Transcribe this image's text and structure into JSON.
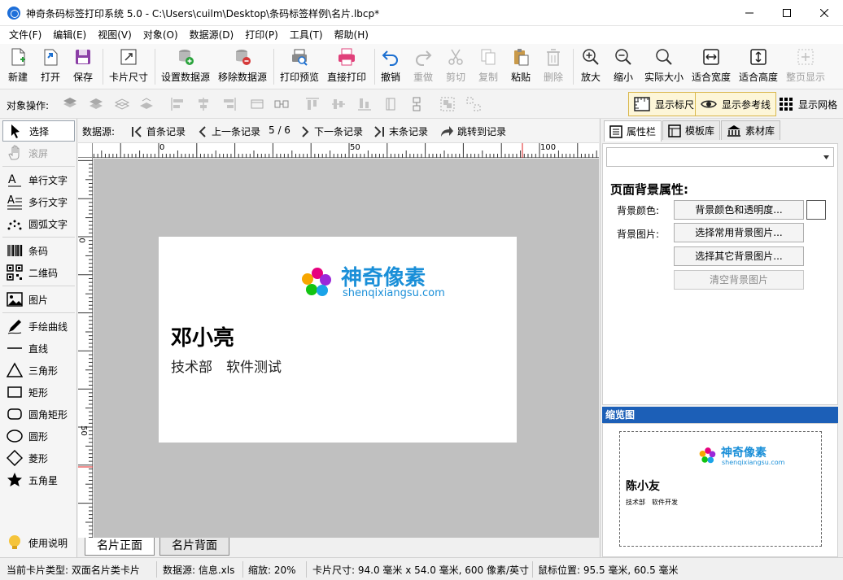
{
  "window": {
    "title": "神奇条码标签打印系统 5.0 - C:\\Users\\cuilm\\Desktop\\条码标签样例\\名片.lbcp*"
  },
  "menu": [
    "文件(F)",
    "编辑(E)",
    "视图(V)",
    "对象(O)",
    "数据源(D)",
    "打印(P)",
    "工具(T)",
    "帮助(H)"
  ],
  "toolbar": {
    "new": "新建",
    "open": "打开",
    "save": "保存",
    "card_size": "卡片尺寸",
    "set_datasource": "设置数据源",
    "remove_datasource": "移除数据源",
    "print_preview": "打印预览",
    "direct_print": "直接打印",
    "undo": "撤销",
    "redo": "重做",
    "cut": "剪切",
    "copy": "复制",
    "paste": "粘贴",
    "delete": "删除",
    "zoom_in": "放大",
    "zoom_out": "缩小",
    "actual_size": "实际大小",
    "fit_width": "适合宽度",
    "fit_height": "适合高度",
    "fit_page": "整页显示"
  },
  "objbar": {
    "label": "对象操作:",
    "show_ruler": "显示标尺",
    "show_guides": "显示参考线",
    "show_grid": "显示网格"
  },
  "tools": {
    "select": "选择",
    "pan": "滚屏",
    "single_text": "单行文字",
    "multi_text": "多行文字",
    "arc_text": "圆弧文字",
    "barcode": "条码",
    "qrcode": "二维码",
    "image": "图片",
    "freehand": "手绘曲线",
    "line": "直线",
    "triangle": "三角形",
    "rect": "矩形",
    "round_rect": "圆角矩形",
    "ellipse": "圆形",
    "diamond": "菱形",
    "star": "五角星",
    "help": "使用说明"
  },
  "nav": {
    "label": "数据源:",
    "first": "首条记录",
    "prev": "上一条记录",
    "counter": "5 / 6",
    "next": "下一条记录",
    "last": "末条记录",
    "jump": "跳转到记录"
  },
  "ruler": {
    "h": [
      "0",
      "50",
      "100"
    ],
    "v": [
      "0",
      "50"
    ]
  },
  "card": {
    "logo_cn": "神奇像素",
    "logo_url": "shenqixiangsu.com",
    "name": "邓小亮",
    "dept_title": "技术部　软件测试"
  },
  "page_tabs": [
    "名片正面",
    "名片背面"
  ],
  "right": {
    "tabs": [
      "属性栏",
      "模板库",
      "素材库"
    ],
    "section_title": "页面背景属性:",
    "bg_color_label": "背景颜色:",
    "bg_color_btn": "背景颜色和透明度...",
    "bg_image_label": "背景图片:",
    "bg_image_common": "选择常用背景图片...",
    "bg_image_other": "选择其它背景图片...",
    "bg_image_clear": "清空背景图片",
    "thumb_title": "缩览图"
  },
  "thumb": {
    "logo_cn": "神奇像素",
    "logo_url": "shenqixiangsu.com",
    "name": "陈小友",
    "dept_title": "技术部　软件开发"
  },
  "status": {
    "card_type": "当前卡片类型: 双面名片类卡片",
    "datasource": "数据源: 信息.xls",
    "zoom": "缩放: 20%",
    "card_size": "卡片尺寸: 94.0 毫米 x 54.0 毫米, 600 像素/英寸",
    "mouse_pos": "鼠标位置: 95.5 毫米, 60.5 毫米"
  },
  "colors": {
    "accent": "#1c5fb7",
    "logo_text": "#1a8fd8",
    "canvas": "#c0c0c0"
  }
}
